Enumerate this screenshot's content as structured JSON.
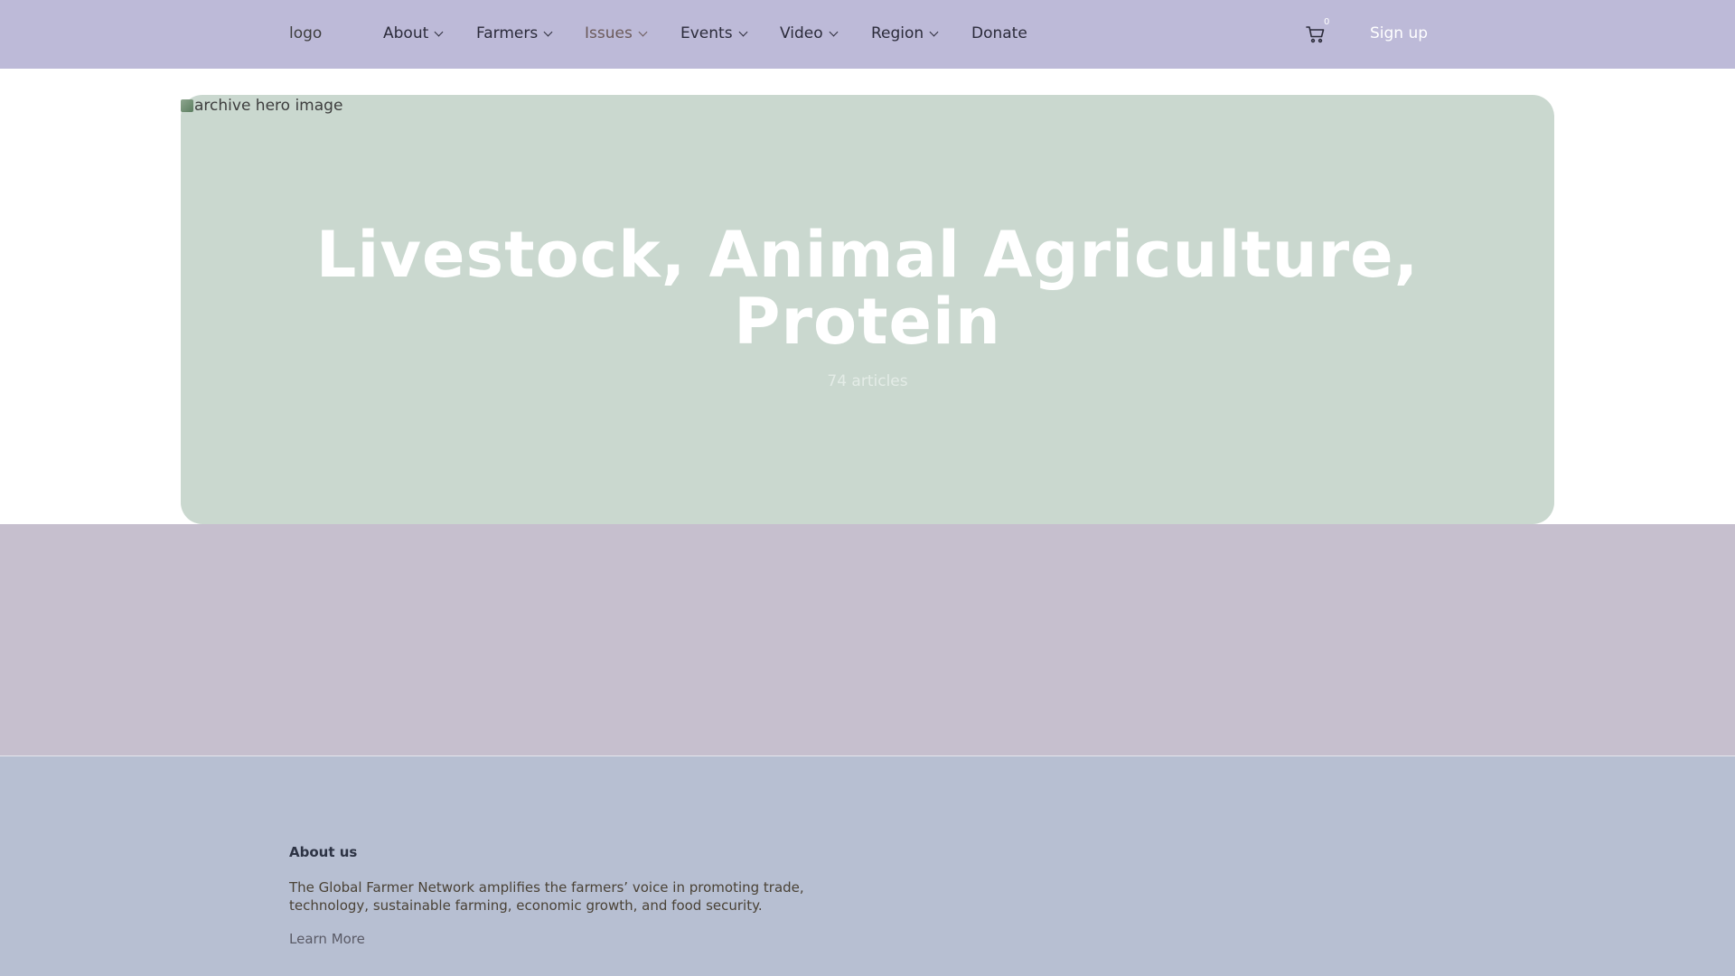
{
  "header": {
    "logo_alt": "logo",
    "nav": [
      {
        "label": "About",
        "has_dropdown": true
      },
      {
        "label": "Farmers",
        "has_dropdown": true
      },
      {
        "label": "Issues",
        "has_dropdown": true,
        "active": true
      },
      {
        "label": "Events",
        "has_dropdown": true
      },
      {
        "label": "Video",
        "has_dropdown": true
      },
      {
        "label": "Region",
        "has_dropdown": true
      },
      {
        "label": "Donate",
        "has_dropdown": false
      }
    ],
    "cart_count": "0",
    "cart_icon": "cart-icon",
    "signup_label": "Sign up"
  },
  "hero": {
    "image_alt": "archive hero image",
    "title": "Livestock, Animal Agriculture, Protein",
    "count_text": "74 articles"
  },
  "footer": {
    "heading": "About us",
    "text": "The Global Farmer Network amplifies the farmers’ voice in promoting trade, technology, sustainable farming, economic growth, and food security.",
    "link_label": "Learn More"
  },
  "colors": {
    "header_bg": "#bdbad8",
    "hero_bg": "#cad8cf",
    "band_bg": "#c6bfce",
    "footer_bg": "#b7bfd2"
  }
}
